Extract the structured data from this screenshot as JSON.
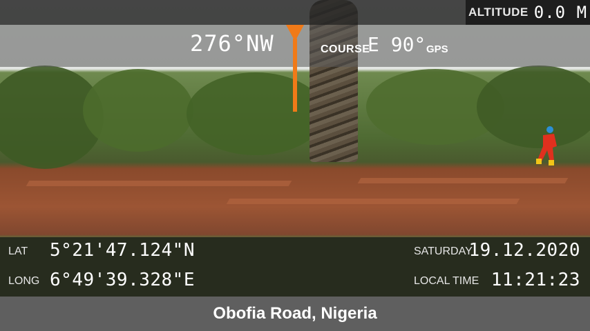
{
  "altitude": {
    "label": "ALTITUDE",
    "value": "0.0 M"
  },
  "compass": {
    "heading": "276°NW",
    "course_label": "COURSE",
    "course_value": "E 90°",
    "gps_label": "GPS",
    "accent": "#f07a18"
  },
  "coordinates": {
    "lat_label": "LAT",
    "lat_value": "5°21'47.124\"N",
    "long_label": "LONG",
    "long_value": "6°49'39.328\"E"
  },
  "datetime": {
    "day_label": "SATURDAY",
    "date_value": "19.12.2020",
    "time_label": "LOCAL TIME",
    "time_value": "11:21:23"
  },
  "location": "Obofia Road, Nigeria"
}
